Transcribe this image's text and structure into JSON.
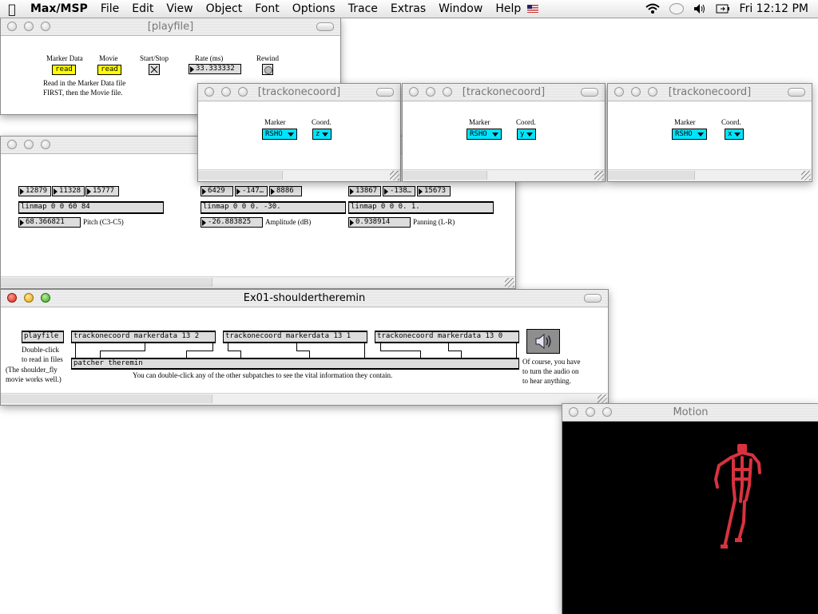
{
  "menubar": {
    "app": "Max/MSP",
    "items": [
      "File",
      "Edit",
      "View",
      "Object",
      "Font",
      "Options",
      "Trace",
      "Extras",
      "Window",
      "Help"
    ],
    "clock": "Fri 12:12 PM"
  },
  "playfile": {
    "title": "[playfile]",
    "labels": {
      "marker_data": "Marker Data",
      "movie": "Movie",
      "start_stop": "Start/Stop",
      "rate": "Rate (ms)",
      "rewind": "Rewind"
    },
    "read1": "read",
    "read2": "read",
    "rate_value": "33.333332",
    "note1": "Read in the Marker Data file",
    "note2": "FIRST, then the Movie file."
  },
  "tracks": [
    {
      "title": "[trackonecoord]",
      "marker_label": "Marker",
      "coord_label": "Coord.",
      "marker": "RSHO",
      "coord": "z"
    },
    {
      "title": "[trackonecoord]",
      "marker_label": "Marker",
      "coord_label": "Coord.",
      "marker": "RSHO",
      "coord": "y"
    },
    {
      "title": "[trackonecoord]",
      "marker_label": "Marker",
      "coord_label": "Coord.",
      "marker": "RSHO",
      "coord": "x"
    }
  ],
  "theremin": {
    "groups": [
      {
        "n1": "12879",
        "n2": "11328",
        "n3": "15777",
        "linmap": "linmap 0 0 60 84",
        "out": "68.366821",
        "label": "Pitch (C3-C5)"
      },
      {
        "n1": "6429",
        "n2": "-147…",
        "n3": "8886",
        "linmap": "linmap 0 0 0. -30.",
        "out": "-26.883825",
        "label": "Amplitude (dB)"
      },
      {
        "n1": "13867",
        "n2": "-138…",
        "n3": "15673",
        "linmap": "linmap 0 0 0. 1.",
        "out": "0.938914",
        "label": "Panning (L-R)"
      }
    ]
  },
  "main": {
    "title": "Ex01-shouldertheremin",
    "playfile_box": "playfile",
    "track1": "trackonecoord markerdata 13 2",
    "track2": "trackonecoord markerdata 13 1",
    "track3": "trackonecoord markerdata 13 0",
    "patcher": "patcher theremin",
    "dbl1": "Double-click",
    "dbl2": "to read in files",
    "note1": "(The shoulder_fly",
    "note2": "movie works well.)",
    "subpatch_note": "You can double-click any of the other subpatches to see the vital information they contain.",
    "audio1": "Of course, you have",
    "audio2": "to turn the audio on",
    "audio3": "to hear anything."
  },
  "motion": {
    "title": "Motion"
  }
}
